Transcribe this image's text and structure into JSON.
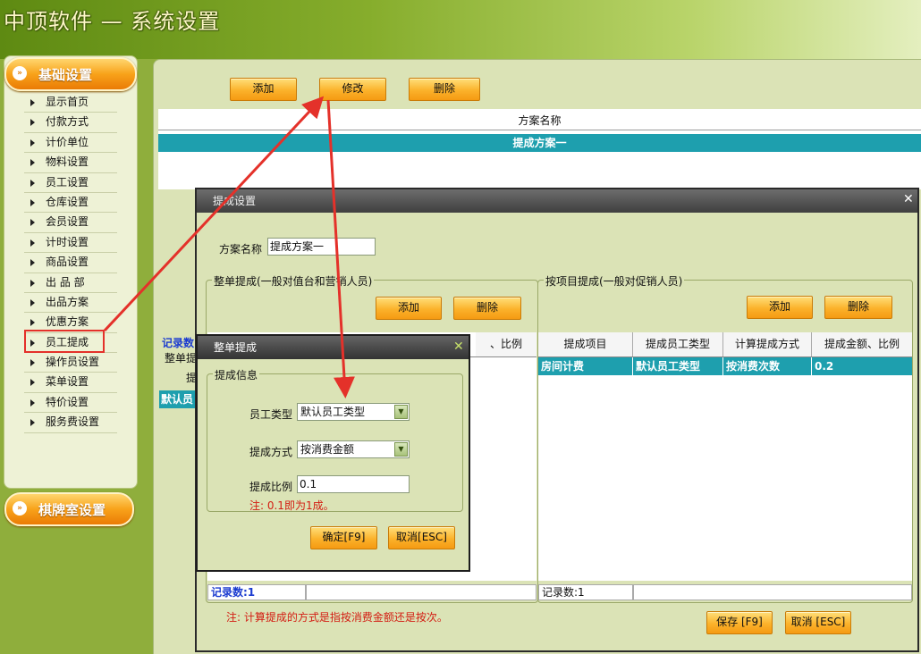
{
  "header": {
    "title": "中顶软件 — 系统设置"
  },
  "left_nav": {
    "section_basic": "基础设置",
    "section_chess": "棋牌室设置",
    "items": [
      "显示首页",
      "付款方式",
      "计价单位",
      "物料设置",
      "员工设置",
      "仓库设置",
      "会员设置",
      "计时设置",
      "商品设置",
      "出 品 部",
      "出品方案",
      "优惠方案",
      "员工提成",
      "操作员设置",
      "菜单设置",
      "特价设置",
      "服务费设置"
    ]
  },
  "main": {
    "toolbar": {
      "add": "添加",
      "edit": "修改",
      "delete": "删除"
    },
    "table_header": "方案名称",
    "table_row": "提成方案一",
    "behind": {
      "record_label": "记录数",
      "group_label": "整单提",
      "col_label": "提",
      "row_label": "默认员"
    }
  },
  "dialog_commission": {
    "title": "提成设置",
    "plan_name_label": "方案名称",
    "plan_name_value": "提成方案一",
    "whole_group_title": "整单提成(一般对值台和营销人员)",
    "whole_add": "添加",
    "whole_delete": "删除",
    "whole_col_partial": "、比例",
    "whole_status": "记录数:1",
    "item_group_title": "按项目提成(一般对促销人员)",
    "item_add": "添加",
    "item_delete": "删除",
    "item_columns": [
      "提成项目",
      "提成员工类型",
      "计算提成方式",
      "提成金额、比例"
    ],
    "item_rows": [
      [
        "房间计费",
        "默认员工类型",
        "按消费次数",
        "0.2"
      ]
    ],
    "item_status": "记录数:1",
    "note": "注: 计算提成的方式是指按消费金额还是按次。",
    "save": "保存 [F9]",
    "cancel": "取消 [ESC]"
  },
  "dialog_whole": {
    "title": "整单提成",
    "group_title": "提成信息",
    "emp_type_label": "员工类型",
    "emp_type_value": "默认员工类型",
    "method_label": "提成方式",
    "method_value": "按消费金额",
    "ratio_label": "提成比例",
    "ratio_value": "0.1",
    "note": "注: 0.1即为1成。",
    "ok": "确定[F9]",
    "cancel": "取消[ESC]"
  },
  "colors": {
    "accent_orange": "#f8a21a",
    "teal": "#1e9fae",
    "panel": "#dbe3b6",
    "arrow_red": "#e4312a"
  }
}
